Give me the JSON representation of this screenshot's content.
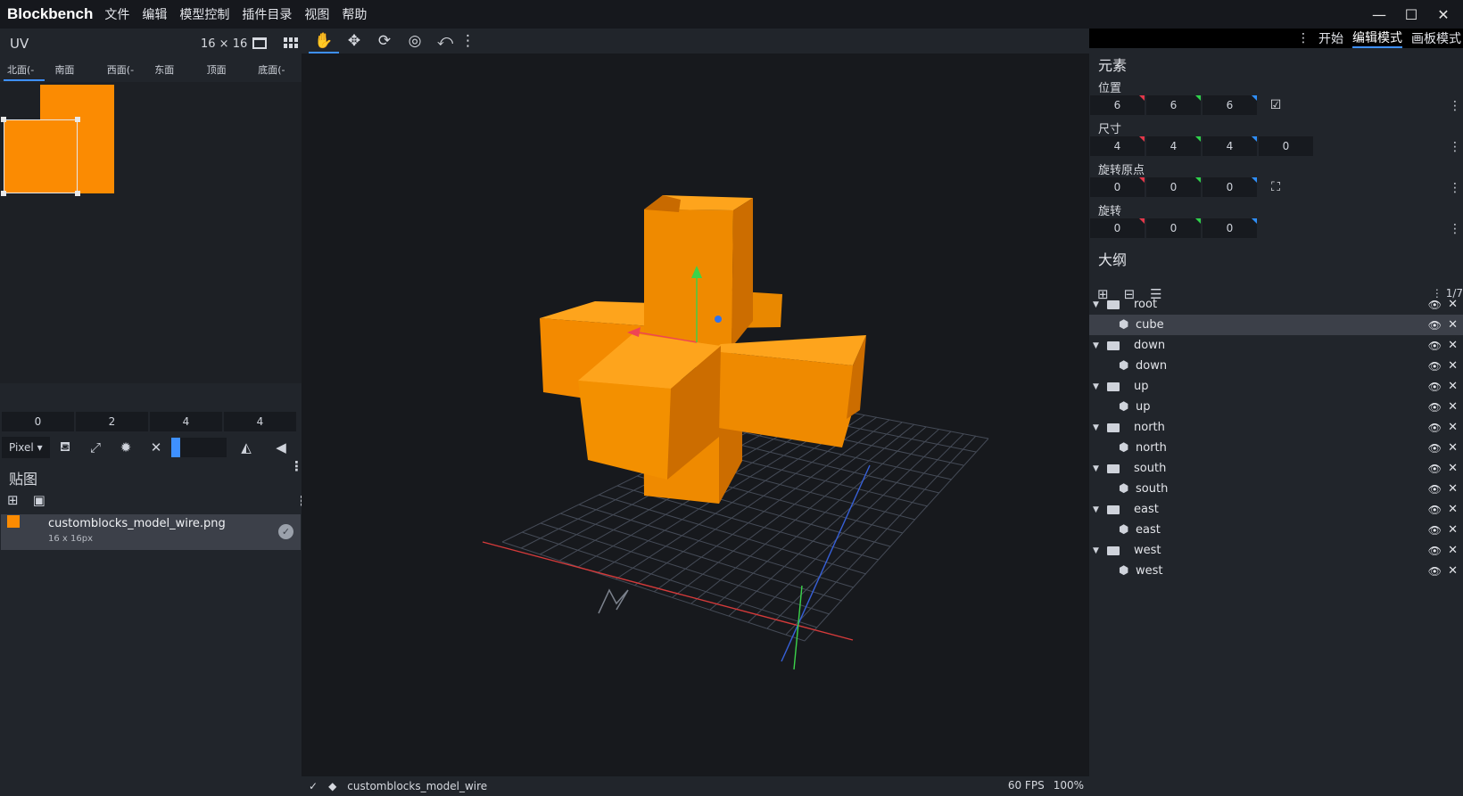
{
  "menubar": {
    "brand": "Blockbench",
    "items": [
      "文件",
      "编辑",
      "模型控制",
      "插件目录",
      "视图",
      "帮助"
    ]
  },
  "window_controls": {
    "minimize": "—",
    "maximize": "☐",
    "close": "✕"
  },
  "uv": {
    "title": "UV",
    "size": "16 × 16",
    "faces": [
      "北面(-x)",
      "南面(+x)",
      "西面(-y)",
      "东面(+y)",
      "顶面(+z)",
      "底面(-z)"
    ],
    "active_face": 0,
    "fields": [
      "0",
      "2",
      "4",
      "4"
    ],
    "snap_mode": "Pixel",
    "texture_color": "#fb8b02"
  },
  "textures": {
    "title": "贴图",
    "items": [
      {
        "name": "customblocks_model_wire.png",
        "size": "16 x 16px"
      }
    ]
  },
  "mode_tabs": {
    "items": [
      "开始",
      "编辑模式",
      "画板模式"
    ],
    "active": 1
  },
  "element": {
    "title": "元素",
    "position": {
      "label": "位置",
      "values": [
        "6",
        "6",
        "6"
      ]
    },
    "size": {
      "label": "尺寸",
      "values": [
        "4",
        "4",
        "4"
      ],
      "inflate": "0"
    },
    "pivot": {
      "label": "旋转原点",
      "values": [
        "0",
        "0",
        "0"
      ]
    },
    "rotation": {
      "label": "旋转",
      "values": [
        "0",
        "0",
        "0"
      ]
    }
  },
  "outliner": {
    "title": "大纲",
    "count": "1/7",
    "rows": [
      {
        "type": "group",
        "label": "root"
      },
      {
        "type": "cube",
        "label": "cube",
        "selected": true
      },
      {
        "type": "group",
        "label": "down"
      },
      {
        "type": "cube",
        "label": "down"
      },
      {
        "type": "group",
        "label": "up"
      },
      {
        "type": "cube",
        "label": "up"
      },
      {
        "type": "group",
        "label": "north"
      },
      {
        "type": "cube",
        "label": "north"
      },
      {
        "type": "group",
        "label": "south"
      },
      {
        "type": "cube",
        "label": "south"
      },
      {
        "type": "group",
        "label": "east"
      },
      {
        "type": "cube",
        "label": "east"
      },
      {
        "type": "group",
        "label": "west"
      },
      {
        "type": "cube",
        "label": "west"
      }
    ]
  },
  "status": {
    "project": "customblocks_model_wire",
    "fps": "60 FPS",
    "zoom": "100%"
  },
  "colors": {
    "accent": "#3e90ff",
    "model": "#fb8b02",
    "panel": "#21252b",
    "viewport": "#17191d"
  }
}
